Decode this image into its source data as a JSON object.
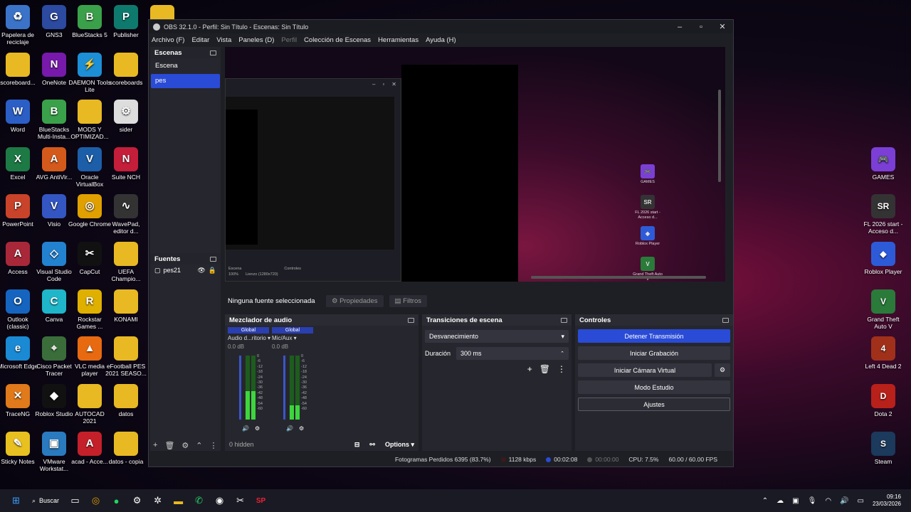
{
  "desktop_left": [
    {
      "label": "Papelera de reciclaje",
      "color": "#3b73c8",
      "glyph": "♻",
      "icon": "recycle-bin-icon"
    },
    {
      "label": "GNS3",
      "color": "#2b4aa0",
      "glyph": "G",
      "icon": "gns3-icon"
    },
    {
      "label": "BlueStacks 5",
      "color": "#3aa14a",
      "glyph": "B",
      "icon": "bluestacks-icon"
    },
    {
      "label": "Publisher",
      "color": "#0e7a6e",
      "glyph": "P",
      "icon": "publisher-icon"
    },
    {
      "label": "",
      "color": "#e8b923",
      "glyph": "",
      "icon": "folder-icon"
    },
    {
      "label": "scoreboard...",
      "color": "#e8b923",
      "glyph": "",
      "icon": "folder-icon"
    },
    {
      "label": "OneNote",
      "color": "#7719aa",
      "glyph": "N",
      "icon": "onenote-icon"
    },
    {
      "label": "DAEMON Tools Lite",
      "color": "#1c8fd6",
      "glyph": "⚡",
      "icon": "daemon-tools-icon"
    },
    {
      "label": "scoreboards",
      "color": "#e8b923",
      "glyph": "",
      "icon": "folder-icon"
    },
    {
      "label": "Word",
      "color": "#2b5fc6",
      "glyph": "W",
      "icon": "word-icon"
    },
    {
      "label": "BlueStacks Multi-Insta...",
      "color": "#3aa14a",
      "glyph": "B",
      "icon": "bluestacks-multi-icon"
    },
    {
      "label": "MODS Y OPTIMIZAD...",
      "color": "#e8b923",
      "glyph": "",
      "icon": "folder-icon"
    },
    {
      "label": "sider",
      "color": "#ddd",
      "glyph": "⚙",
      "icon": "sider-icon"
    },
    {
      "label": "Excel",
      "color": "#1d7a45",
      "glyph": "X",
      "icon": "excel-icon"
    },
    {
      "label": "AVG AntiVir...",
      "color": "#d45a1c",
      "glyph": "A",
      "icon": "avg-icon"
    },
    {
      "label": "Oracle VirtualBox",
      "color": "#1d5ea8",
      "glyph": "V",
      "icon": "virtualbox-icon"
    },
    {
      "label": "Suite NCH",
      "color": "#c41e3a",
      "glyph": "N",
      "icon": "nch-icon"
    },
    {
      "label": "PowerPoint",
      "color": "#c9432a",
      "glyph": "P",
      "icon": "powerpoint-icon"
    },
    {
      "label": "Visio",
      "color": "#3456c2",
      "glyph": "V",
      "icon": "visio-icon"
    },
    {
      "label": "Google Chrome",
      "color": "#e0a000",
      "glyph": "◎",
      "icon": "chrome-icon"
    },
    {
      "label": "WavePad, editor d...",
      "color": "#333",
      "glyph": "∿",
      "icon": "wavepad-icon"
    },
    {
      "label": "Access",
      "color": "#a8283a",
      "glyph": "A",
      "icon": "access-icon"
    },
    {
      "label": "Visual Studio Code",
      "color": "#2382d0",
      "glyph": "◇",
      "icon": "vscode-icon"
    },
    {
      "label": "CapCut",
      "color": "#111",
      "glyph": "✂",
      "icon": "capcut-icon"
    },
    {
      "label": "UEFA Champio...",
      "color": "#e8b923",
      "glyph": "",
      "icon": "folder-icon"
    },
    {
      "label": "Outlook (classic)",
      "color": "#1565c0",
      "glyph": "O",
      "icon": "outlook-icon"
    },
    {
      "label": "Canva",
      "color": "#1fb6c9",
      "glyph": "C",
      "icon": "canva-icon"
    },
    {
      "label": "Rockstar Games ...",
      "color": "#e0b000",
      "glyph": "R",
      "icon": "rockstar-icon"
    },
    {
      "label": "KONAMI",
      "color": "#e8b923",
      "glyph": "",
      "icon": "folder-icon"
    },
    {
      "label": "Microsoft Edge",
      "color": "#1a8ad4",
      "glyph": "e",
      "icon": "edge-icon"
    },
    {
      "label": "Cisco Packet Tracer",
      "color": "#3a6d3a",
      "glyph": "⌖",
      "icon": "packet-tracer-icon"
    },
    {
      "label": "VLC media player",
      "color": "#e86a10",
      "glyph": "▲",
      "icon": "vlc-icon"
    },
    {
      "label": "eFootball PES 2021 SEASO...",
      "color": "#e8b923",
      "glyph": "",
      "icon": "folder-icon"
    },
    {
      "label": "TraceNG",
      "color": "#e07a1a",
      "glyph": "✕",
      "icon": "traceng-icon"
    },
    {
      "label": "Roblox Studio",
      "color": "#111",
      "glyph": "◆",
      "icon": "roblox-studio-icon"
    },
    {
      "label": "AUTOCAD 2021",
      "color": "#e8b923",
      "glyph": "",
      "icon": "folder-icon"
    },
    {
      "label": "datos",
      "color": "#e8b923",
      "glyph": "",
      "icon": "folder-icon"
    },
    {
      "label": "Sticky Notes",
      "color": "#e8c020",
      "glyph": "✎",
      "icon": "sticky-notes-icon"
    },
    {
      "label": "VMware Workstat...",
      "color": "#2a7ac0",
      "glyph": "▣",
      "icon": "vmware-icon"
    },
    {
      "label": "acad - Acce...",
      "color": "#c4202a",
      "glyph": "A",
      "icon": "autocad-icon"
    },
    {
      "label": "datos - copia",
      "color": "#e8b923",
      "glyph": "",
      "icon": "folder-icon"
    }
  ],
  "desktop_right": [
    {
      "label": "GAMES",
      "color": "#7b3fd6",
      "glyph": "🎮",
      "icon": "games-icon"
    },
    {
      "label": "FL 2026 start - Acceso d...",
      "color": "#333",
      "glyph": "SR",
      "icon": "fl2026-icon"
    },
    {
      "label": "Roblox Player",
      "color": "#2d5bd8",
      "glyph": "◆",
      "icon": "roblox-player-icon"
    },
    {
      "label": "Grand Theft Auto V",
      "color": "#2a7a3a",
      "glyph": "V",
      "icon": "gta-icon"
    },
    {
      "label": "Left 4 Dead 2",
      "color": "#a0301a",
      "glyph": "4",
      "icon": "left4dead-icon"
    },
    {
      "label": "Dota 2",
      "color": "#b8201a",
      "glyph": "D",
      "icon": "dota-icon"
    },
    {
      "label": "Steam",
      "color": "#1b3a5c",
      "glyph": "S",
      "icon": "steam-icon"
    }
  ],
  "obs": {
    "title": "OBS 32.1.0 - Perfil: Sin Título - Escenas: Sin Título",
    "menu": [
      "Archivo (F)",
      "Editar",
      "Vista",
      "Paneles (D)",
      "Perfil",
      "Colección de Escenas",
      "Herramientas",
      "Ayuda (H)"
    ],
    "scenes_title": "Escenas",
    "scenes": [
      "Escena",
      "pes"
    ],
    "sources_title": "Fuentes",
    "sources": [
      "pes21"
    ],
    "no_source": "Ninguna fuente seleccionada",
    "properties": "Propiedades",
    "filters": "Filtros",
    "nested": {
      "scene_tab": "Escena",
      "controls_tab": "Controles",
      "zoom": "100%",
      "canvas": "Lienzo (1280x720)"
    },
    "mixer": {
      "title": "Mezclador de audio",
      "channels": [
        {
          "badge": "Global",
          "name": "Audio d...ritorio",
          "db": "0.0 dB",
          "level": 0.45
        },
        {
          "badge": "Global",
          "name": "Mic/Aux",
          "db": "0.0 dB",
          "level": 0.22
        }
      ],
      "scale": [
        "0",
        "-6",
        "-12",
        "-18",
        "-24",
        "-30",
        "-36",
        "-42",
        "-48",
        "-54",
        "-60"
      ],
      "hidden": "0 hidden",
      "options": "Options"
    },
    "transitions": {
      "title": "Transiciones de escena",
      "selected": "Desvanecimiento",
      "duration_label": "Duración",
      "duration": "300 ms"
    },
    "controls": {
      "title": "Controles",
      "stop_stream": "Detener Transmisión",
      "start_record": "Iniciar Grabación",
      "virtual_cam": "Iniciar Cámara Virtual",
      "studio": "Modo Estudio",
      "settings": "Ajustes"
    },
    "status": {
      "dropped": "Fotogramas Perdidos 6395 (83.7%)",
      "bitrate": "1128 kbps",
      "stream_time": "00:02:08",
      "rec_time": "00:00:00",
      "cpu": "CPU: 7.5%",
      "fps": "60.00 / 60.00 FPS"
    }
  },
  "preview_icons": [
    "GAMES",
    "FL 2026 start - Acceso d...",
    "Roblox Player",
    "Grand Theft Auto V"
  ],
  "taskbar": {
    "search": "Buscar",
    "time": "09:16",
    "date": "23/03/2026"
  },
  "colors": {
    "accent": "#2a4bd6",
    "window": "#1e1f25"
  }
}
